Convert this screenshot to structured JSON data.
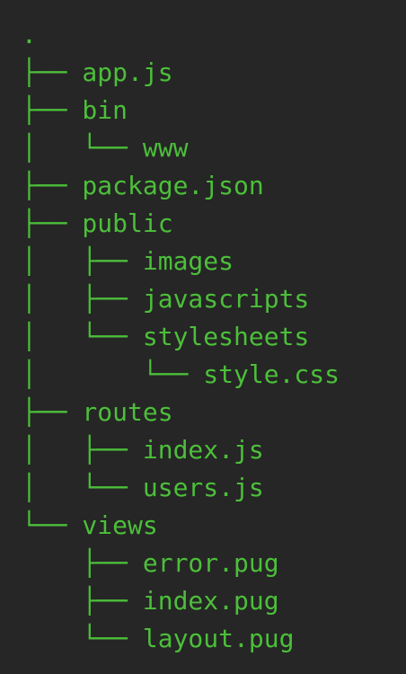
{
  "tree": {
    "lines": [
      ".",
      "├── app.js",
      "├── bin",
      "│   └── www",
      "├── package.json",
      "├── public",
      "│   ├── images",
      "│   ├── javascripts",
      "│   └── stylesheets",
      "│       └── style.css",
      "├── routes",
      "│   ├── index.js",
      "│   └── users.js",
      "└── views",
      "    ├── error.pug",
      "    ├── index.pug",
      "    └── layout.pug"
    ],
    "text_color": "#4cbf3a",
    "background_color": "#262626"
  }
}
